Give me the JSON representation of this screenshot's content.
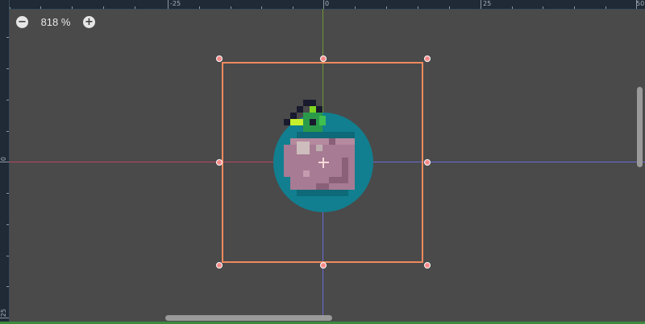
{
  "zoom": {
    "minus_icon": "minus-circle-icon",
    "zoom_text": "818 %",
    "plus_icon": "plus-circle-icon"
  },
  "rulers": {
    "top_labels": [
      "-25",
      "0",
      "25",
      "50"
    ],
    "left_labels": [
      "0",
      "25"
    ]
  },
  "colors": {
    "selection": "#f08a5d",
    "x_axis": "#b54860",
    "y_axis": "#6c9a3a",
    "handle": "#f58a8a",
    "sprite_bg": "#117f8f"
  }
}
